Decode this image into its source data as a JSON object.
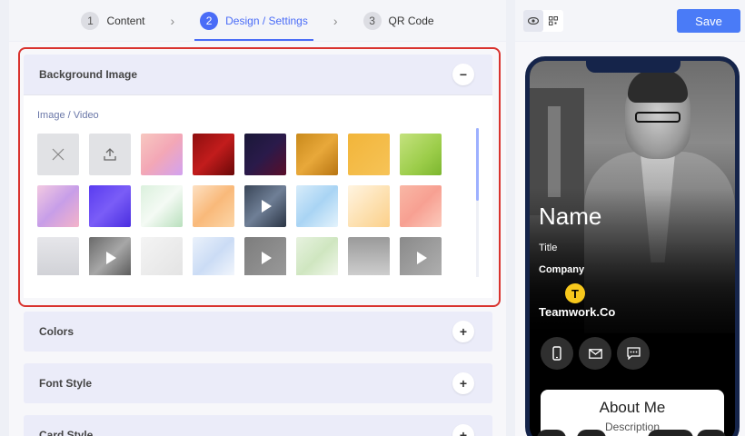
{
  "stepper": {
    "steps": [
      {
        "num": "1",
        "label": "Content"
      },
      {
        "num": "2",
        "label": "Design / Settings"
      },
      {
        "num": "3",
        "label": "QR Code"
      }
    ],
    "active_index": 1
  },
  "sections": {
    "background": {
      "title": "Background Image",
      "toggle": "−",
      "expanded": true,
      "sub_label": "Image / Video"
    },
    "colors": {
      "title": "Colors",
      "toggle": "+"
    },
    "font_style": {
      "title": "Font Style",
      "toggle": "+"
    },
    "card_style": {
      "title": "Card Style",
      "toggle": "+"
    }
  },
  "background_tiles": [
    {
      "kind": "none",
      "icon": "close-icon",
      "fill": "#e1e2e5"
    },
    {
      "kind": "upload",
      "icon": "upload-icon",
      "fill": "#e1e2e5"
    },
    {
      "kind": "image",
      "fill": "linear-gradient(135deg,#f7c7c0,#f3a7b6 50%,#d2a2f0)"
    },
    {
      "kind": "image",
      "fill": "linear-gradient(135deg,#8e0f0f,#c21c1c 50%,#6a0808)"
    },
    {
      "kind": "image",
      "fill": "linear-gradient(135deg,#1a1838,#2a1a4a 50%,#5a0e2a)"
    },
    {
      "kind": "image",
      "fill": "linear-gradient(135deg,#c98a1c,#e8a83a 50%,#b87512)"
    },
    {
      "kind": "image",
      "fill": "linear-gradient(135deg,#f2b53a,#f6c357)"
    },
    {
      "kind": "image",
      "fill": "linear-gradient(135deg,#c4e27e,#9ccd4a 60%,#7cb62f)"
    },
    {
      "kind": "image",
      "fill": "linear-gradient(135deg,#f2c9e1,#c79ee8 50%,#f4b3c9)"
    },
    {
      "kind": "image",
      "fill": "linear-gradient(135deg,#5a3cf0,#7a5df7 50%,#4a2ee0)"
    },
    {
      "kind": "image",
      "fill": "linear-gradient(135deg,#dbf1dd,#f4faf4 50%,#b9e0bd)"
    },
    {
      "kind": "image",
      "fill": "linear-gradient(135deg,#fde0c2,#f9b97a 50%,#fcd6a8)"
    },
    {
      "kind": "video",
      "fill": "linear-gradient(135deg,#3a4658,#6f7f96 50%,#2a3444)"
    },
    {
      "kind": "image",
      "fill": "linear-gradient(135deg,#d7ecfa,#a9d4f4 50%,#e4f3fc)"
    },
    {
      "kind": "image",
      "fill": "linear-gradient(135deg,#fff4e1,#fde2b4 50%,#fbd08a)"
    },
    {
      "kind": "image",
      "fill": "linear-gradient(135deg,#f9b7a5,#f7a092 50%,#fccabc)"
    },
    {
      "kind": "image",
      "fill": "linear-gradient(180deg,#e6e6ea,#cfd0d5)"
    },
    {
      "kind": "video",
      "fill": "linear-gradient(135deg,#6a6a6a,#a7a7a7 50%,#555)"
    },
    {
      "kind": "image",
      "fill": "linear-gradient(135deg,#f4f4f4,#e3e3e3)"
    },
    {
      "kind": "image",
      "fill": "linear-gradient(135deg,#eaf1fb,#cbdcf5 50%,#f5f8fd)"
    },
    {
      "kind": "video",
      "fill": "linear-gradient(135deg,#7d7d7d,#9a9a9a)"
    },
    {
      "kind": "image",
      "fill": "linear-gradient(135deg,#e7f2df,#cfe6c0 50%,#f3f8ee)"
    },
    {
      "kind": "image",
      "fill": "linear-gradient(180deg,#9a9a9a,#d2d2d2)"
    },
    {
      "kind": "video",
      "fill": "linear-gradient(135deg,#8a8a8a,#b0b0b0)"
    }
  ],
  "preview": {
    "save_label": "Save",
    "view_toggle": [
      {
        "icon": "eye-icon"
      },
      {
        "icon": "qr-icon"
      }
    ],
    "name": "Name",
    "title": "Title",
    "company": "Company",
    "logo_letter": "T",
    "brand": "Teamwork.Co",
    "contact_icons": [
      {
        "icon": "phone-icon",
        "glyph": "▯"
      },
      {
        "icon": "mail-icon",
        "glyph": "✉"
      },
      {
        "icon": "chat-icon",
        "glyph": "☰"
      }
    ],
    "about_title": "About Me",
    "about_desc": "Description"
  },
  "colors": {
    "accent": "#4a6cf7",
    "highlight": "#d9332e",
    "save": "#4a7bf7",
    "phone_frame": "#15244a"
  }
}
